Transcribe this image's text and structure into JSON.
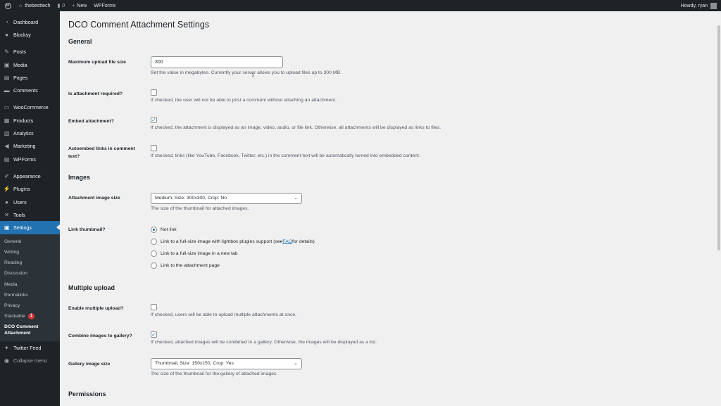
{
  "adminbar": {
    "site_name": "thebesttech",
    "comments_count": "0",
    "new_label": "New",
    "wpforms_label": "WPForms",
    "howdy": "Howdy, ryan"
  },
  "sidebar": {
    "items": [
      {
        "label": "Dashboard",
        "icon": "dashboard-icon"
      },
      {
        "label": "Blocksy",
        "icon": "blocksy-icon"
      },
      {
        "label": "Posts",
        "icon": "pin-icon"
      },
      {
        "label": "Media",
        "icon": "media-icon"
      },
      {
        "label": "Pages",
        "icon": "pages-icon"
      },
      {
        "label": "Comments",
        "icon": "comments-icon"
      },
      {
        "label": "WooCommerce",
        "icon": "woocommerce-icon"
      },
      {
        "label": "Products",
        "icon": "products-icon"
      },
      {
        "label": "Analytics",
        "icon": "analytics-icon"
      },
      {
        "label": "Marketing",
        "icon": "megaphone-icon"
      },
      {
        "label": "WPForms",
        "icon": "wpforms-icon"
      },
      {
        "label": "Appearance",
        "icon": "brush-icon"
      },
      {
        "label": "Plugins",
        "icon": "plug-icon"
      },
      {
        "label": "Users",
        "icon": "users-icon"
      },
      {
        "label": "Tools",
        "icon": "wrench-icon"
      },
      {
        "label": "Settings",
        "icon": "settings-icon"
      },
      {
        "label": "Twitter Feed",
        "icon": "twitter-icon"
      },
      {
        "label": "Collapse menu",
        "icon": "collapse-icon"
      }
    ],
    "submenu": [
      {
        "label": "General"
      },
      {
        "label": "Writing"
      },
      {
        "label": "Reading"
      },
      {
        "label": "Discussion"
      },
      {
        "label": "Media"
      },
      {
        "label": "Permalinks"
      },
      {
        "label": "Privacy"
      },
      {
        "label": "Stackable",
        "badge": "1"
      },
      {
        "label": "DCO Comment Attachment"
      }
    ]
  },
  "page": {
    "title": "DCO Comment Attachment Settings",
    "sections": {
      "general": "General",
      "images": "Images",
      "multiple": "Multiple upload",
      "permissions": "Permissions"
    },
    "fields": {
      "max_upload": {
        "label": "Maximum upload file size",
        "value": "300",
        "desc": "Set the value in megabytes. Currently your server allows you to upload files up to 300 MB."
      },
      "required": {
        "label": "Is attachment required?",
        "checked": false,
        "desc": "If checked, the user will not be able to post a comment without attaching an attachment."
      },
      "embed": {
        "label": "Embed attachment?",
        "checked": true,
        "desc": "If checked, the attachment is displayed as an image, video, audio, or file link. Otherwise, all attachments will be displayed as links to files."
      },
      "autoembed": {
        "label": "Autoembed links in comment text?",
        "checked": false,
        "desc": "If checked, links (like YouTube, Facebook, Twitter, etc.) in the comment text will be automatically turned into embedded content."
      },
      "image_size": {
        "label": "Attachment image size",
        "value": "Medium, Size: 300x300, Crop: No",
        "desc": "The size of the thumbnail for attached images."
      },
      "link_thumb": {
        "label": "Link thumbnail?",
        "options": [
          {
            "label": "Not link",
            "selected": true
          },
          {
            "label_pre": "Link to a full-size image with lightbox plugins support (see ",
            "link": "FAQ",
            "label_post": " for details)",
            "selected": false
          },
          {
            "label": "Link to a full-size image in a new tab",
            "selected": false
          },
          {
            "label": "Link to the attachment page",
            "selected": false
          }
        ]
      },
      "multi_upload": {
        "label": "Enable multiple upload?",
        "checked": false,
        "desc": "If checked, users will be able to upload multiple attachments at once."
      },
      "gallery": {
        "label": "Combine images to gallery?",
        "checked": true,
        "desc": "If checked, attached images will be combined to a gallery. Otherwise, the images will be displayed as a list."
      },
      "gallery_size": {
        "label": "Gallery image size",
        "value": "Thumbnail, Size: 150x150, Crop: Yes",
        "desc": "The size of the thumbnail for the gallery of attached images."
      }
    }
  }
}
